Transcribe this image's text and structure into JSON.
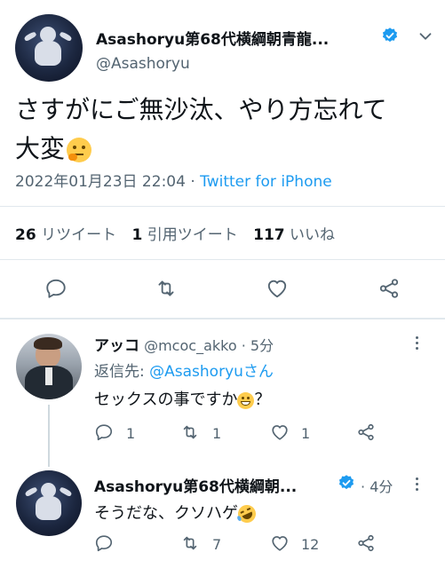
{
  "main_tweet": {
    "display_name": "Asashoryu第68代横綱朝青龍...",
    "handle": "@Asashoryu",
    "text_line1": "さすがにご無沙汰、やり方忘れて",
    "text_line2": "大変",
    "text_emoji": "thinking-face-emoji",
    "timestamp": "2022年01月23日 22:04",
    "separator": "·",
    "source": "Twitter for iPhone",
    "stats": {
      "retweets_count": "26",
      "retweets_label": "リツイート",
      "quotes_count": "1",
      "quotes_label": "引用ツイート",
      "likes_count": "117",
      "likes_label": "いいね"
    },
    "actions": [
      "reply-icon",
      "retweet-icon",
      "like-icon",
      "share-icon"
    ]
  },
  "replies": [
    {
      "display_name": "アッコ",
      "handle": "@mcoc_akko",
      "separator": "·",
      "time": "5分",
      "replying_prefix": "返信先: ",
      "replying_to": "@Asashoryuさん",
      "text": "セックスの事ですか",
      "text_after_emoji": "？",
      "emoji": "grinning-emoji",
      "reply_count": "1",
      "retweet_count": "1",
      "like_count": "1"
    },
    {
      "display_name": "Asashoryu第68代横綱朝...",
      "handle": "",
      "separator": "·",
      "time": "4分",
      "text": "そうだな、クソハゲ",
      "emoji": "rolling-laughing-emoji",
      "reply_count": "",
      "retweet_count": "7",
      "like_count": "12"
    }
  ],
  "colors": {
    "accent": "#1d9bf0",
    "text": "#0f1419",
    "secondary": "#536471",
    "divider": "#e1e8ed"
  }
}
